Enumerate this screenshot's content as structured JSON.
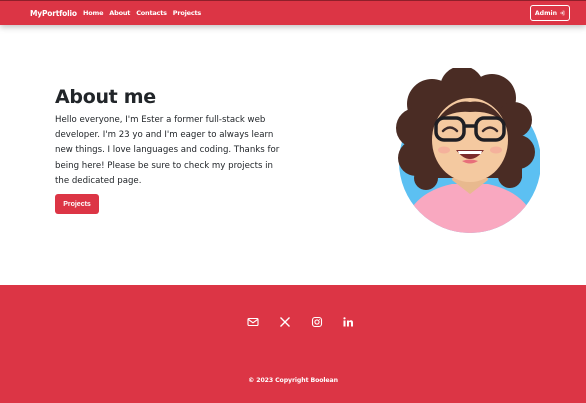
{
  "nav": {
    "brand": "MyPortfolio",
    "links": [
      "Home",
      "About",
      "Contacts",
      "Projects"
    ],
    "admin_label": "Admin"
  },
  "about": {
    "title": "About me",
    "text": "Hello everyone, I'm Ester a former full-stack web developer. I'm 23 yo and I'm eager to always learn new things. I love languages and coding. Thanks for being here! Please be sure to check my projects in the dedicated page.",
    "button_label": "Projects"
  },
  "footer": {
    "socials": [
      "mail-icon",
      "x-icon",
      "instagram-icon",
      "linkedin-icon"
    ],
    "copyright": "© 2023 Copyright Boolean"
  },
  "colors": {
    "accent": "#dc3545",
    "text": "#212529",
    "avatar_bg": "#5cc0f2"
  }
}
